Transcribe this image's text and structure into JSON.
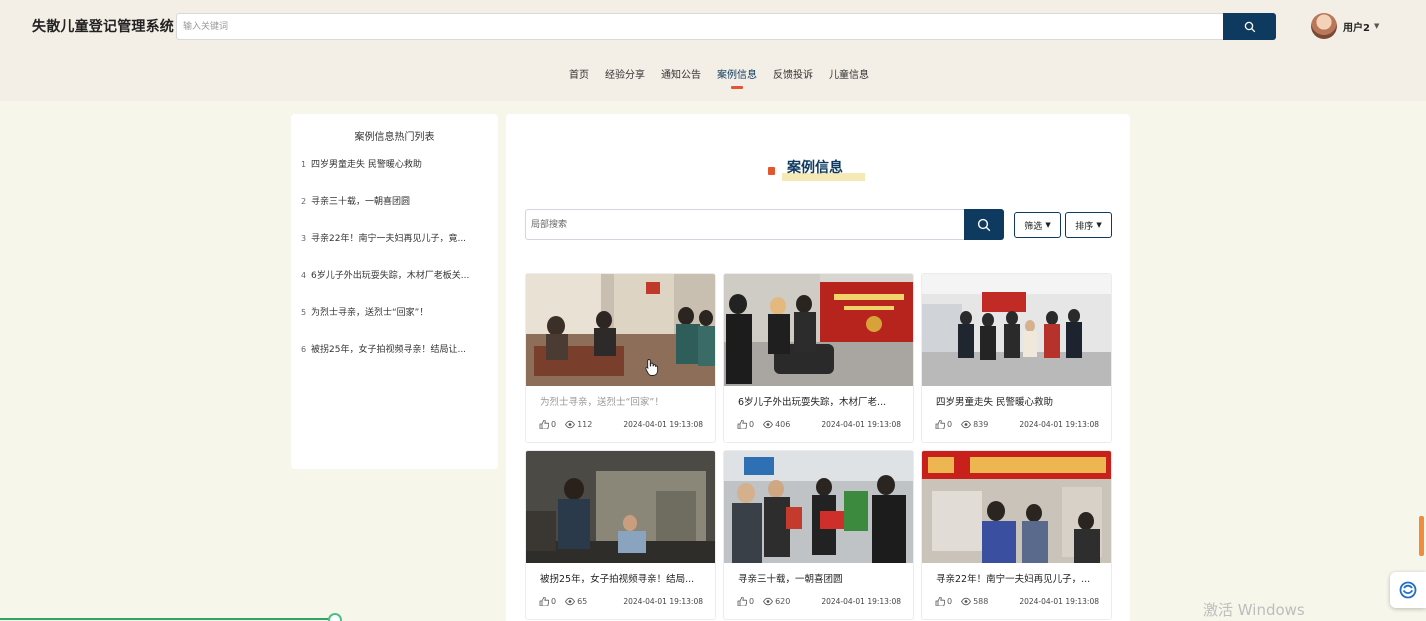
{
  "app": {
    "title": "失散儿童登记管理系统",
    "search_placeholder": "输入关键词",
    "user_name": "用户2"
  },
  "nav": {
    "items": [
      "首页",
      "经验分享",
      "通知公告",
      "案例信息",
      "反馈投诉",
      "儿童信息"
    ],
    "active": "案例信息"
  },
  "sidebar": {
    "title": "案例信息热门列表",
    "items": [
      {
        "num": "1",
        "text": "四岁男童走失 民警暖心救助"
      },
      {
        "num": "2",
        "text": "寻亲三十载，一朝喜团圆"
      },
      {
        "num": "3",
        "text": "寻亲22年！南宁一夫妇再见儿子，竟..."
      },
      {
        "num": "4",
        "text": "6岁儿子外出玩耍失踪，木材厂老板关..."
      },
      {
        "num": "5",
        "text": "为烈士寻亲，送烈士“回家”！"
      },
      {
        "num": "6",
        "text": "被拐25年，女子拍视频寻亲！结局让..."
      }
    ]
  },
  "main": {
    "title": "案例信息",
    "search_placeholder": "局部搜索",
    "filter_label": "筛选",
    "sort_label": "排序"
  },
  "cards": [
    {
      "title": "为烈士寻亲，送烈士“回家”！",
      "likes": "0",
      "views": "112",
      "date": "2024-04-01 19:13:08"
    },
    {
      "title": "6岁儿子外出玩耍失踪，木材厂老...",
      "likes": "0",
      "views": "406",
      "date": "2024-04-01 19:13:08"
    },
    {
      "title": "四岁男童走失 民警暖心救助",
      "likes": "0",
      "views": "839",
      "date": "2024-04-01 19:13:08"
    },
    {
      "title": "被拐25年，女子拍视频寻亲！结局...",
      "likes": "0",
      "views": "65",
      "date": "2024-04-01 19:13:08"
    },
    {
      "title": "寻亲三十载，一朝喜团圆",
      "likes": "0",
      "views": "620",
      "date": "2024-04-01 19:13:08"
    },
    {
      "title": "寻亲22年！南宁一夫妇再见儿子，...",
      "likes": "0",
      "views": "588",
      "date": "2024-04-01 19:13:08"
    }
  ],
  "overlay": {
    "watermark": "激活 Windows"
  },
  "colors": {
    "primary": "#0f3a5f",
    "accent": "#e4572e",
    "header_bg": "#f3efe6",
    "page_bg": "#f7f6ea"
  },
  "icons": {
    "search": "search-icon",
    "like": "thumb-up-icon",
    "views": "eye-icon",
    "dropdown": "caret-down-icon",
    "float": "assistant-icon"
  }
}
